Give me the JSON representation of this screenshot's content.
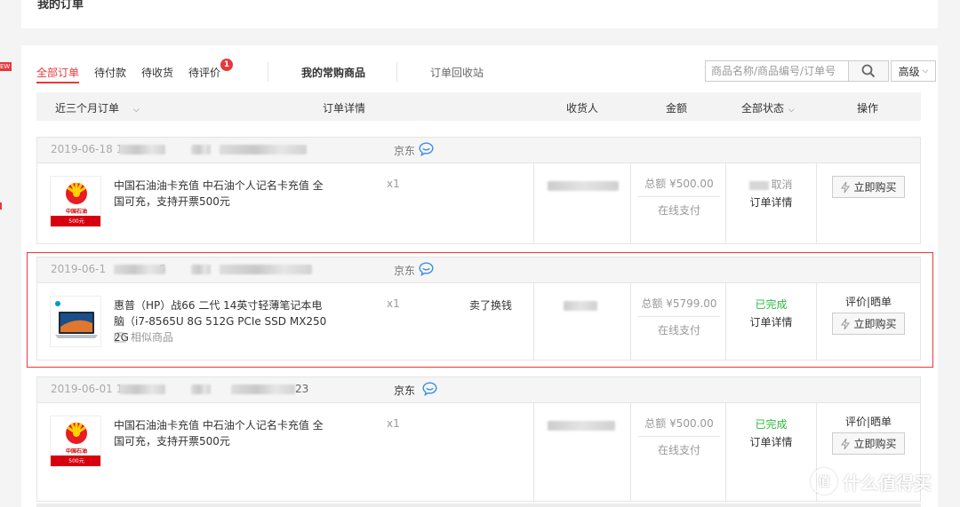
{
  "page": {
    "title": "我的订单"
  },
  "tabs": {
    "all": "全部订单",
    "pending_pay": "待付款",
    "pending_receive": "待收货",
    "pending_review": "待评价",
    "pending_review_badge": "1",
    "frequent": "我的常购商品",
    "recycle": "订单回收站"
  },
  "search": {
    "placeholder": "商品名称/商品编号/订单号",
    "advanced_label": "高级"
  },
  "table_header": {
    "period": "近三个月订单",
    "detail": "订单详情",
    "consignee": "收货人",
    "amount": "金额",
    "status": "全部状态",
    "ops": "操作"
  },
  "orders": [
    {
      "date": "2019-06-18",
      "date_suffix": "1",
      "shop": "京东",
      "product_name": "中国石油油卡充值 中石油个人记名卡充值 全国可充，支持开票500元",
      "qty": "x1",
      "amount": "总额 ¥500.00",
      "pay_method": "在线支付",
      "status": "取消",
      "detail_link": "订单详情",
      "buy_label": "立即购买",
      "thumb": "petrochina-card",
      "thumb_brand": "中国石油",
      "thumb_value": "500元"
    },
    {
      "date": "2019-06-1",
      "date_suffix": "5",
      "shop": "京东",
      "product_name": "惠普（HP）战66 二代 14英寸轻薄笔记本电脑（i7-8565U 8G 512G PCIe SSD MX250 2G",
      "similar_label": "相似商品",
      "qty": "x1",
      "extra": "卖了换钱",
      "amount": "总额 ¥5799.00",
      "pay_method": "在线支付",
      "status": "已完成",
      "detail_link": "订单详情",
      "review_label": "评价|晒单",
      "buy_label": "立即购买",
      "thumb": "hp-laptop"
    },
    {
      "date": "2019-06-01",
      "date_suffix": "1",
      "order_tail": "23",
      "shop": "京东",
      "product_name": "中国石油油卡充值 中石油个人记名卡充值 全国可充，支持开票500元",
      "qty": "x1",
      "amount": "总额 ¥500.00",
      "pay_method": "在线支付",
      "status": "已完成",
      "detail_link": "订单详情",
      "review_label": "评价|晒单",
      "buy_label": "立即购买",
      "thumb": "petrochina-card",
      "thumb_brand": "中国石油",
      "thumb_value": "500元"
    }
  ],
  "watermark": {
    "text": "什么值得买",
    "logo_glyph": "值"
  },
  "colors": {
    "accent": "#e4393c",
    "success": "#2db93f",
    "highlight_border": "#e4393c"
  }
}
